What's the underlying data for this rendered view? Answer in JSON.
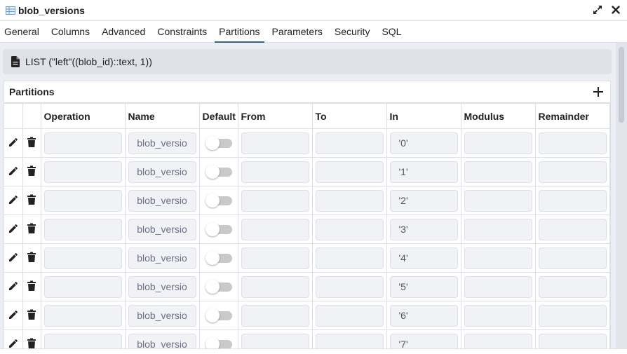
{
  "window": {
    "title": "blob_versions",
    "icons": {
      "table": "table-icon",
      "maximize": "expand-icon",
      "close": "close-icon"
    }
  },
  "tabs": [
    {
      "label": "General",
      "active": false
    },
    {
      "label": "Columns",
      "active": false
    },
    {
      "label": "Advanced",
      "active": false
    },
    {
      "label": "Constraints",
      "active": false
    },
    {
      "label": "Partitions",
      "active": true
    },
    {
      "label": "Parameters",
      "active": false
    },
    {
      "label": "Security",
      "active": false
    },
    {
      "label": "SQL",
      "active": false
    }
  ],
  "partition_expression": {
    "icon": "document-icon",
    "text": "LIST (\"left\"((blob_id)::text, 1))"
  },
  "partitions_panel": {
    "title": "Partitions",
    "add_icon": "plus-icon",
    "columns": [
      "",
      "",
      "Operation",
      "Name",
      "Default",
      "From",
      "To",
      "In",
      "Modulus",
      "Remainder"
    ],
    "rows": [
      {
        "operation": "",
        "name": "blob_versio",
        "default": false,
        "from": "",
        "to": "",
        "in": "'0'",
        "modulus": "",
        "remainder": ""
      },
      {
        "operation": "",
        "name": "blob_versio",
        "default": false,
        "from": "",
        "to": "",
        "in": "'1'",
        "modulus": "",
        "remainder": ""
      },
      {
        "operation": "",
        "name": "blob_versio",
        "default": false,
        "from": "",
        "to": "",
        "in": "'2'",
        "modulus": "",
        "remainder": ""
      },
      {
        "operation": "",
        "name": "blob_versio",
        "default": false,
        "from": "",
        "to": "",
        "in": "'3'",
        "modulus": "",
        "remainder": ""
      },
      {
        "operation": "",
        "name": "blob_versio",
        "default": false,
        "from": "",
        "to": "",
        "in": "'4'",
        "modulus": "",
        "remainder": ""
      },
      {
        "operation": "",
        "name": "blob_versio",
        "default": false,
        "from": "",
        "to": "",
        "in": "'5'",
        "modulus": "",
        "remainder": ""
      },
      {
        "operation": "",
        "name": "blob_versio",
        "default": false,
        "from": "",
        "to": "",
        "in": "'6'",
        "modulus": "",
        "remainder": ""
      },
      {
        "operation": "",
        "name": "blob_versio",
        "default": false,
        "from": "",
        "to": "",
        "in": "'7'",
        "modulus": "",
        "remainder": ""
      }
    ]
  },
  "colors": {
    "accent": "#326690",
    "background": "#ebeef3",
    "field_bg": "#f0f2f6",
    "border": "#dde0e6"
  }
}
